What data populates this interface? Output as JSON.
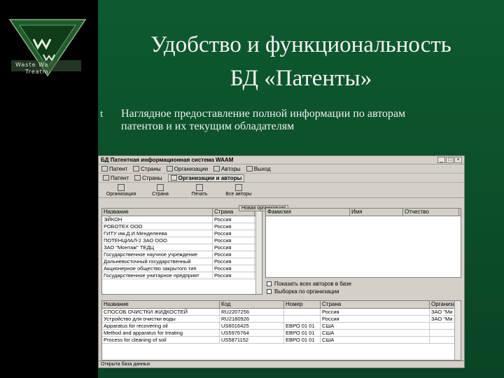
{
  "slide": {
    "title_line1": "Удобство и функциональность",
    "title_line2": "БД «Патенты»",
    "bullet_symbol": "t",
    "bullet_text": "Наглядное предоставление полной информации по авторам патентов и их текущим обладателям"
  },
  "logo": {
    "line1": "Waste Wa",
    "line2": "Treatm"
  },
  "app": {
    "title": "БД Патентная информационная система WAAM",
    "menu": [
      "Патент",
      "Страны",
      "Организации",
      "Авторы",
      "Выход"
    ],
    "tabs": [
      "Патент",
      "Страны",
      "Организации и авторы"
    ],
    "toolbar": [
      "Организация",
      "Страна",
      "Печать",
      "Все авторы"
    ],
    "context_label": "Новая организация",
    "orgs_header": [
      "Название",
      "Страна"
    ],
    "orgs": [
      [
        "ЭЙКОН",
        "Россия"
      ],
      [
        "РОБОТЕХ ООО",
        "Россия"
      ],
      [
        "ГИТУ им.Д.И.Менделеева",
        "Россия"
      ],
      [
        "ПОТЕНЦИАЛ-2 ЗАО ООО",
        "Россия"
      ],
      [
        "ЗАО \"Монтаж\" ТЕДЦ",
        "Россия"
      ],
      [
        "Государственное научное учреждение",
        "Россия"
      ],
      [
        "Дальневосточный государственный",
        "Россия"
      ],
      [
        "Акционерное общество закрытого тип",
        "Россия"
      ],
      [
        "Государственное унитарное предприят",
        "Россия"
      ]
    ],
    "authors_header": [
      "Фамилия",
      "Имя",
      "Отчество"
    ],
    "checkboxes": [
      "Показать всех авторов в базе",
      "Выборка по организации"
    ],
    "patents_header": [
      "Название",
      "Код",
      "Номер",
      "Страна",
      "Организация"
    ],
    "patents": [
      [
        "СПОСОБ ОЧИСТКИ ЖИДКОСТЕЙ",
        "RU2207256",
        "",
        "Россия",
        "ЗАО \"Ми"
      ],
      [
        "Устройство для очистки воды",
        "RU2180926",
        "",
        "Россия",
        "ЗАО \"Ми"
      ],
      [
        "Apparatus for recovering oil",
        "US6016425",
        "ЕВРО 01 01",
        "США",
        ""
      ],
      [
        "Method and apparatus for treating",
        "US5976764",
        "ЕВРО 01 01",
        "США",
        ""
      ],
      [
        "Process for cleaning of soil",
        "US5871152",
        "ЕВРО 01 01",
        "США",
        ""
      ]
    ],
    "status": "Открыта база данных"
  }
}
